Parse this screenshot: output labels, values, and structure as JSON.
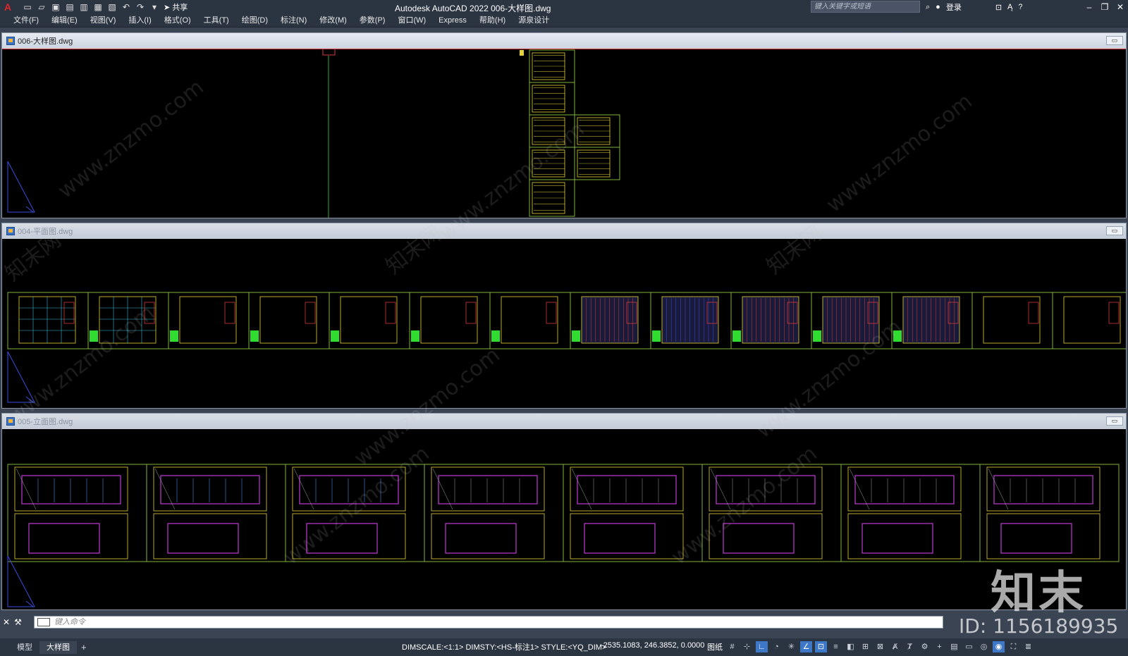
{
  "app": {
    "logo": "A",
    "title": "Autodesk AutoCAD 2022    006-大样图.dwg",
    "share_label": "共享",
    "search_placeholder": "键入关键字或短语",
    "login_label": "登录"
  },
  "menu": [
    "文件(F)",
    "编辑(E)",
    "视图(V)",
    "插入(I)",
    "格式(O)",
    "工具(T)",
    "绘图(D)",
    "标注(N)",
    "修改(M)",
    "参数(P)",
    "窗口(W)",
    "Express",
    "帮助(H)",
    "源泉设计"
  ],
  "drawings": [
    {
      "name": "006-大样图.dwg",
      "active": true
    },
    {
      "name": "004-平面图.dwg",
      "active": false
    },
    {
      "name": "005-立面图.dwg",
      "active": false
    }
  ],
  "command": {
    "placeholder": "键入命令"
  },
  "status": {
    "tabs": [
      "模型",
      "大样图"
    ],
    "active_tab": "大样图",
    "info": "DIMSCALE:<1:1> DIMSTY:<HS-标注1> STYLE:<YQ_DIM>",
    "coords": "-2535.1083, 246.3852, 0.0000",
    "paper": "图纸"
  },
  "watermark": {
    "site": "www.znzmo.com",
    "brand": "知末",
    "brand_net": "知末网",
    "id": "ID: 1156189935"
  },
  "colors": {
    "frame": "#7fb33a",
    "yellow": "#e8d23a",
    "red": "#d33a3a",
    "magenta": "#c23ad6",
    "blue": "#3a4ee0",
    "green_line": "#2faa3a"
  }
}
